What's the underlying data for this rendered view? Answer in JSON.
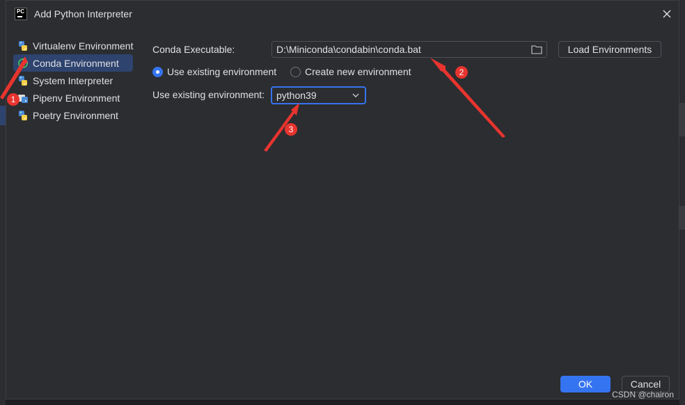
{
  "window": {
    "title": "Add Python Interpreter",
    "logo_text": "PC"
  },
  "sidebar": {
    "items": [
      {
        "label": "Virtualenv Environment",
        "icon": "python-icon"
      },
      {
        "label": "Conda Environment",
        "icon": "conda-icon",
        "selected": true
      },
      {
        "label": "System Interpreter",
        "icon": "python-icon"
      },
      {
        "label": "Pipenv Environment",
        "icon": "pipenv-icon"
      },
      {
        "label": "Poetry Environment",
        "icon": "python-icon"
      }
    ]
  },
  "main": {
    "conda_label": "Conda Executable:",
    "conda_path": "D:\\Miniconda\\condabin\\conda.bat",
    "load_button": "Load Environments",
    "radio_existing": "Use existing environment",
    "radio_new": "Create new environment",
    "existing_label": "Use existing environment:",
    "env_value": "python39"
  },
  "footer": {
    "ok": "OK",
    "cancel": "Cancel"
  },
  "annotations": {
    "badge1": "1",
    "badge2": "2",
    "badge3": "3"
  },
  "watermark": "CSDN @chairon",
  "colors": {
    "accent": "#3574f0",
    "annotation": "#e8342f",
    "selected_bg": "#2e436e"
  }
}
